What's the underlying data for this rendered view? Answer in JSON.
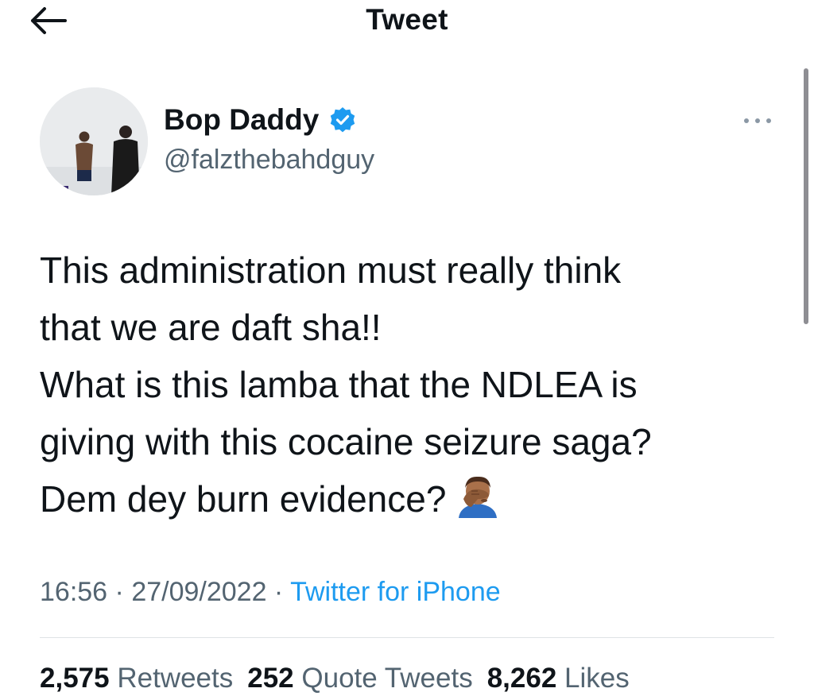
{
  "header": {
    "title": "Tweet",
    "back_icon": "arrow-left-icon"
  },
  "author": {
    "display_name": "Bop Daddy",
    "handle": "@falzthebahdguy",
    "verified": true,
    "verified_color": "#1d9bf0"
  },
  "tweet": {
    "lines": [
      "This administration must really think",
      "that we are daft sha!!",
      "What is this lamba that the NDLEA is",
      "giving with this cocaine seizure saga?",
      "Dem dey burn evidence?"
    ],
    "emoji": "facepalm-emoji"
  },
  "meta": {
    "time": "16:56",
    "separator": " · ",
    "date": "27/09/2022",
    "source": "Twitter for iPhone"
  },
  "stats": {
    "retweets_count": "2,575",
    "retweets_label": "Retweets",
    "quote_count": "252",
    "quote_label": "Quote Tweets",
    "likes_count": "8,262",
    "likes_label": "Likes"
  },
  "colors": {
    "text": "#0f1419",
    "secondary": "#536471",
    "link": "#1d9bf0"
  }
}
